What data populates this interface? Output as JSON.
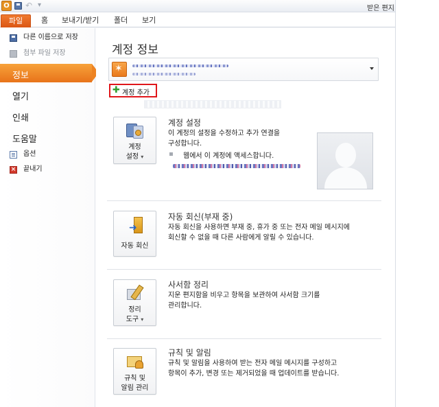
{
  "window": {
    "app_icon": "O",
    "title": "받은 편지"
  },
  "ribbon": {
    "tabs": [
      "파일",
      "홈",
      "보내기/받기",
      "폴더",
      "보기"
    ]
  },
  "backstage_nav": {
    "save_as": "다른 이름으로 저장",
    "save_attachments": "첨부 파일 저장",
    "info": "정보",
    "open": "열기",
    "print": "인쇄",
    "help": "도움말",
    "options": "옵션",
    "exit": "끝내기"
  },
  "main": {
    "title": "계정 정보",
    "add_account": "계정 추가",
    "sections": [
      {
        "button": [
          "계정",
          "설정"
        ],
        "title": "계정 설정",
        "desc": [
          "이 계정의 설정을 수정하고 추가 연결을",
          "구성합니다."
        ],
        "bullet": "웹에서 이 계정에 액세스합니다."
      },
      {
        "button": [
          "자동 회신"
        ],
        "title": "자동 회신(부재 중)",
        "desc": [
          "자동 회신을 사용하면 부재 중, 휴가 중 또는 전자 메일 메시지에",
          "회신할 수 없을 때 다른 사람에게 알릴 수 있습니다."
        ]
      },
      {
        "button": [
          "정리",
          "도구"
        ],
        "title": "사서함 정리",
        "desc": [
          "지운 편지함을 비우고 항목을 보관하여 사서함 크기를",
          "관리합니다."
        ]
      },
      {
        "button": [
          "규칙 및",
          "알림 관리"
        ],
        "title": "규칙 및 알림",
        "desc": [
          "규칙 및 알림을 사용하여 받는 전자 메일 메시지를 구성하고",
          "항목이 추가, 변경 또는 제거되었을 때 업데이트를 받습니다."
        ]
      }
    ]
  },
  "icons": {
    "acct": "account-settings-icon",
    "auto": "auto-reply-icon",
    "clean": "cleanup-tools-icon",
    "rules": "rules-alerts-icon"
  },
  "colors": {
    "accent": "#e8731a",
    "file_tab": "#db5614",
    "highlight_border": "#e0161a"
  }
}
